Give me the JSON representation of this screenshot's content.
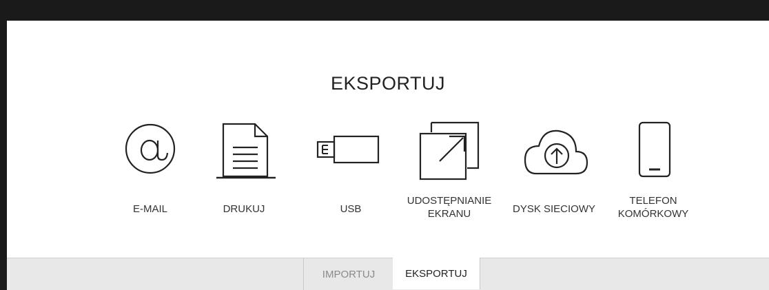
{
  "dialog": {
    "title": "EKSPORTUJ"
  },
  "options": [
    {
      "label": "E-MAIL",
      "icon": "email-icon"
    },
    {
      "label": "DRUKUJ",
      "icon": "document-icon"
    },
    {
      "label": "USB",
      "icon": "usb-icon"
    },
    {
      "label": "UDOSTĘPNIANIE\nEKRANU",
      "icon": "screen-share-icon"
    },
    {
      "label": "DYSK SIECIOWY",
      "icon": "cloud-upload-icon"
    },
    {
      "label": "TELEFON\nKOMÓRKOWY",
      "icon": "mobile-phone-icon"
    }
  ],
  "tabs": {
    "import_label": "IMPORTUJ",
    "export_label": "EKSPORTUJ",
    "active": "EKSPORTUJ"
  },
  "colors": {
    "background": "#1a1a1a",
    "panel": "#ffffff",
    "tab_bar": "#e8e8e8",
    "icon_stroke": "#222222"
  }
}
